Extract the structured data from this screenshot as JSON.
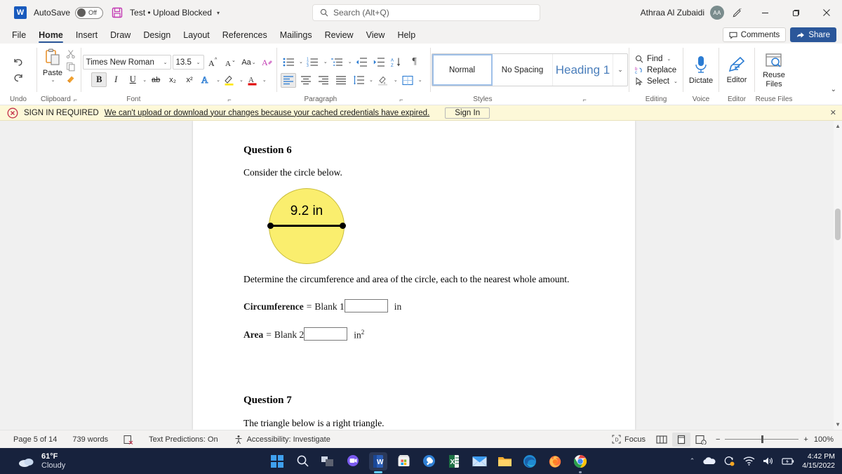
{
  "titlebar": {
    "app_icon": "word-logo-icon",
    "autosave_label": "AutoSave",
    "autosave_state": "Off",
    "save_icon": "save-icon",
    "doc_title": "Test • Upload Blocked",
    "title_caret": "▾",
    "search_placeholder": "Search (Alt+Q)",
    "search_icon": "search-icon",
    "user_name": "Athraa Al Zubaidi",
    "avatar_initials": "AA",
    "pen_icon": "pen-edit-icon",
    "minimize": "—",
    "restore": "▢",
    "close": "✕"
  },
  "tabs": {
    "items": [
      {
        "label": "File",
        "active": false
      },
      {
        "label": "Home",
        "active": true
      },
      {
        "label": "Insert",
        "active": false
      },
      {
        "label": "Draw",
        "active": false
      },
      {
        "label": "Design",
        "active": false
      },
      {
        "label": "Layout",
        "active": false
      },
      {
        "label": "References",
        "active": false
      },
      {
        "label": "Mailings",
        "active": false
      },
      {
        "label": "Review",
        "active": false
      },
      {
        "label": "View",
        "active": false
      },
      {
        "label": "Help",
        "active": false
      }
    ],
    "comments_label": "Comments",
    "share_label": "Share"
  },
  "ribbon": {
    "undo": {
      "group_label": "Undo",
      "undo_icon": "undo-arrow-icon",
      "redo_icon": "redo-arrow-icon"
    },
    "clipboard": {
      "group_label": "Clipboard",
      "paste_label": "Paste",
      "paste_caret": "⌄",
      "cut_icon": "scissors-icon",
      "copy_icon": "copy-icon",
      "format_painter_icon": "format-painter-icon",
      "dialog_launcher": "⌐"
    },
    "font": {
      "group_label": "Font",
      "font_name": "Times New Roman",
      "font_size": "13.5",
      "grow_font": "A",
      "shrink_font": "A",
      "change_case": "Aa",
      "clear_formatting_icon": "clear-formatting-icon",
      "bold": "B",
      "italic": "I",
      "underline": "U",
      "strikethrough": "ab",
      "subscript": "x₂",
      "superscript": "x²",
      "text_effects_icon": "text-effects-icon",
      "highlight_icon": "text-highlight-icon",
      "font_color_icon": "font-color-icon",
      "dialog_launcher": "⌐"
    },
    "paragraph": {
      "group_label": "Paragraph",
      "bullets_icon": "bullet-list-icon",
      "numbering_icon": "numbered-list-icon",
      "multilevel_icon": "multilevel-list-icon",
      "decrease_indent_icon": "decrease-indent-icon",
      "increase_indent_icon": "increase-indent-icon",
      "sort_icon": "sort-az-icon",
      "show_marks_icon": "paragraph-mark-icon",
      "align_left_icon": "align-left-icon",
      "align_center_icon": "align-center-icon",
      "align_right_icon": "align-right-icon",
      "justify_icon": "justify-icon",
      "line_spacing_icon": "line-spacing-icon",
      "shading_icon": "shading-icon",
      "borders_icon": "borders-icon",
      "dialog_launcher": "⌐"
    },
    "styles": {
      "group_label": "Styles",
      "items": [
        {
          "label": "Normal",
          "selected": true
        },
        {
          "label": "No Spacing",
          "selected": false
        },
        {
          "label": "Heading 1",
          "selected": false
        }
      ],
      "more_caret": "⌄",
      "dialog_launcher": "⌐"
    },
    "editing": {
      "group_label": "Editing",
      "find_label": "Find",
      "find_icon": "search-icon",
      "find_caret": "⌄",
      "replace_label": "Replace",
      "replace_icon": "replace-icon",
      "select_label": "Select",
      "select_icon": "select-cursor-icon",
      "select_caret": "⌄"
    },
    "voice": {
      "group_label": "Voice",
      "dictate_label": "Dictate",
      "dictate_icon": "microphone-icon"
    },
    "editor": {
      "group_label": "Editor",
      "editor_label": "Editor",
      "editor_icon": "editor-pen-icon"
    },
    "reuse": {
      "group_label": "Reuse Files",
      "reuse_label": "Reuse\nFiles",
      "reuse_label_line1": "Reuse",
      "reuse_label_line2": "Files",
      "reuse_icon": "reuse-files-icon"
    },
    "collapse_caret": "⌄"
  },
  "warning": {
    "icon": "error-circle-icon",
    "title": "SIGN IN REQUIRED",
    "message": "We can't upload or download your changes because your cached credentials have expired.",
    "button_label": "Sign In",
    "close": "✕",
    "bg_color": "#fdf8d8"
  },
  "document": {
    "q6_heading": "Question 6",
    "q6_intro": "Consider the circle below.",
    "figure": {
      "diameter_label": "9.2 in",
      "fill_color": "#faee6e",
      "stroke_color": "#c9bd3b"
    },
    "q6_prompt": "Determine the circumference and area of the circle, each to the nearest whole amount.",
    "answers": [
      {
        "label": "Circumference",
        "equals": "=",
        "blank": "Blank 1",
        "unit": "in",
        "unit_sup": ""
      },
      {
        "label": "Area",
        "equals": "=",
        "blank": "Blank 2",
        "unit": "in",
        "unit_sup": "2"
      }
    ],
    "q7_heading": "Question 7",
    "q7_intro": "The triangle below is a right triangle."
  },
  "statusbar": {
    "page": "Page 5 of 14",
    "words": "739 words",
    "proofing_icon": "proofing-errors-icon",
    "predictions": "Text Predictions: On",
    "accessibility_icon": "accessibility-icon",
    "accessibility": "Accessibility: Investigate",
    "focus_label": "Focus",
    "focus_icon": "focus-mode-icon",
    "web_layout_icon": "web-layout-icon",
    "print_layout_icon": "print-layout-icon",
    "read_mode_icon": "read-mode-icon",
    "zoom_out": "−",
    "zoom_in": "+",
    "zoom_level": "100%"
  },
  "taskbar": {
    "weather_temp": "61°F",
    "weather_desc": "Cloudy",
    "weather_icon": "cloud-icon",
    "icons": [
      {
        "name": "start-windows-icon",
        "label": "Start"
      },
      {
        "name": "search-icon",
        "label": "Search"
      },
      {
        "name": "task-view-icon",
        "label": "Task View"
      },
      {
        "name": "chat-icon",
        "label": "Chat"
      },
      {
        "name": "word-icon",
        "label": "Word"
      },
      {
        "name": "microsoft-store-icon",
        "label": "Microsoft Store"
      },
      {
        "name": "tools-icon",
        "label": "Tools"
      },
      {
        "name": "excel-icon",
        "label": "Excel"
      },
      {
        "name": "mail-icon",
        "label": "Mail"
      },
      {
        "name": "file-explorer-icon",
        "label": "File Explorer"
      },
      {
        "name": "edge-icon",
        "label": "Microsoft Edge"
      },
      {
        "name": "firefox-icon",
        "label": "Firefox"
      },
      {
        "name": "chrome-icon",
        "label": "Google Chrome"
      }
    ],
    "tray": {
      "chevron": "⌃",
      "onedrive_icon": "onedrive-icon",
      "update_icon": "windows-update-icon",
      "wifi_icon": "wifi-icon",
      "volume_icon": "volume-icon",
      "battery_icon": "battery-icon",
      "time": "4:42 PM",
      "date": "4/15/2022"
    }
  }
}
